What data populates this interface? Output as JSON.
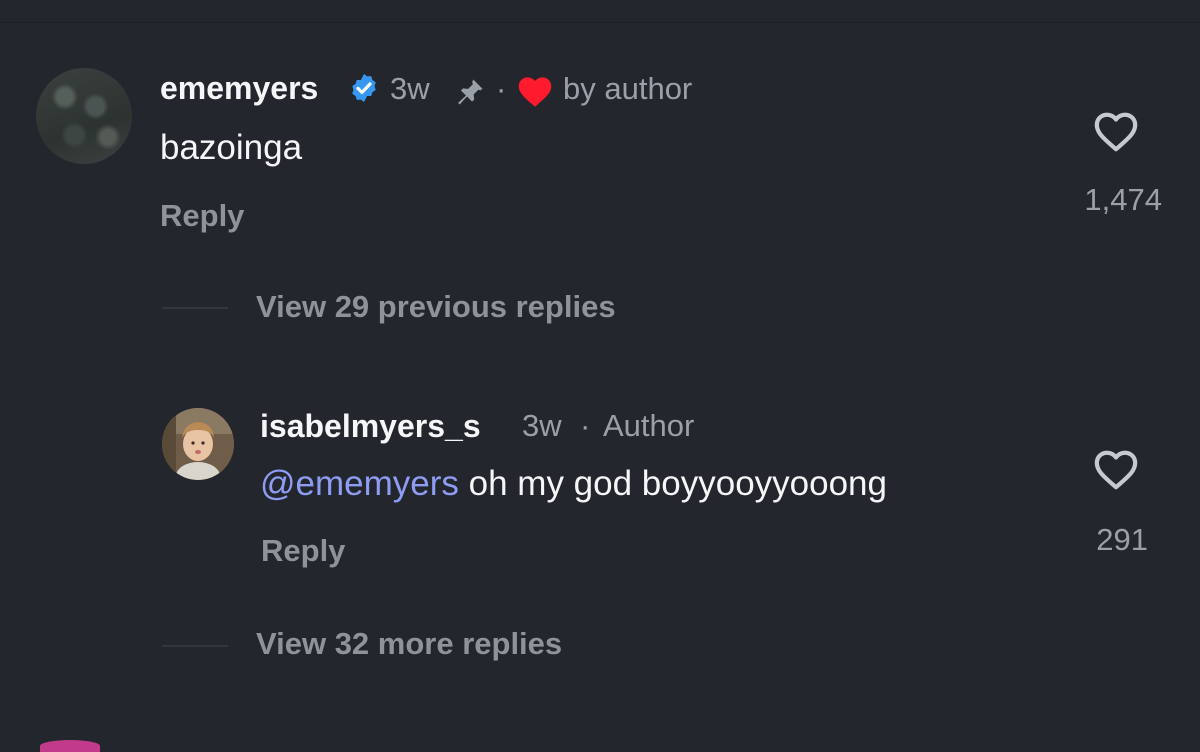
{
  "comments": [
    {
      "username": "ememyers",
      "verified": true,
      "time": "3w",
      "pinned": true,
      "separator": "·",
      "liked_by_author_label": "by author",
      "text": "bazoinga",
      "reply_label": "Reply",
      "like_count": "1,474",
      "view_replies_label": "View 29 previous replies"
    },
    {
      "username": "isabelmyers_s",
      "time": "3w",
      "separator": "·",
      "badge": "Author",
      "mention": "@ememyers",
      "text": "oh my god boyyooyyooong",
      "reply_label": "Reply",
      "like_count": "291",
      "view_replies_label": "View 32 more replies"
    }
  ],
  "colors": {
    "background": "#23262c",
    "mention": "#8e9cf4",
    "verified": "#3897f0",
    "heart": "#ff1a2d"
  },
  "icons": [
    "verified-badge-icon",
    "pin-icon",
    "heart-filled-icon",
    "heart-outline-icon"
  ]
}
